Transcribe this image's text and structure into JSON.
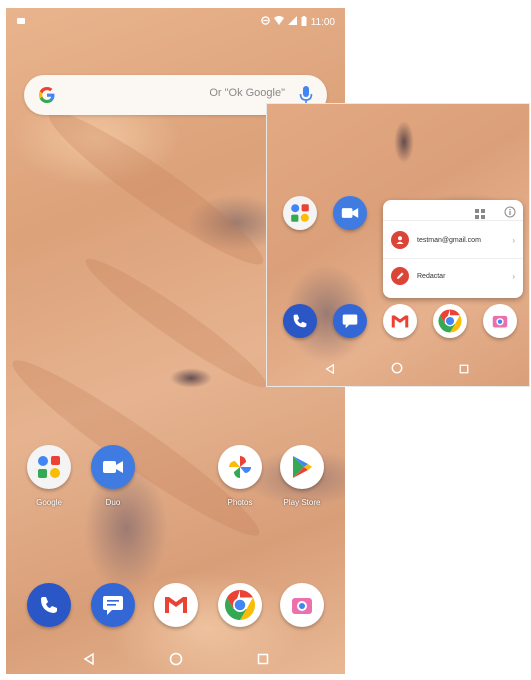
{
  "status_bar": {
    "time": "11:00"
  },
  "search": {
    "hint": "Or \"Ok Google\""
  },
  "home": {
    "row1_labels": [
      "Google",
      "Duo",
      "Photos",
      "Play Store"
    ]
  },
  "inset": {
    "shortcuts": [
      {
        "label": "testman@gmail.com"
      },
      {
        "label": "Redactar"
      }
    ]
  },
  "colors": {
    "google_blue": "#4285f4",
    "google_red": "#ea4335",
    "google_yellow": "#fbbc05",
    "google_green": "#34a853",
    "phone_blue": "#2a56c6",
    "messages_blue": "#3367d6",
    "duo_blue": "#3f7be0"
  }
}
